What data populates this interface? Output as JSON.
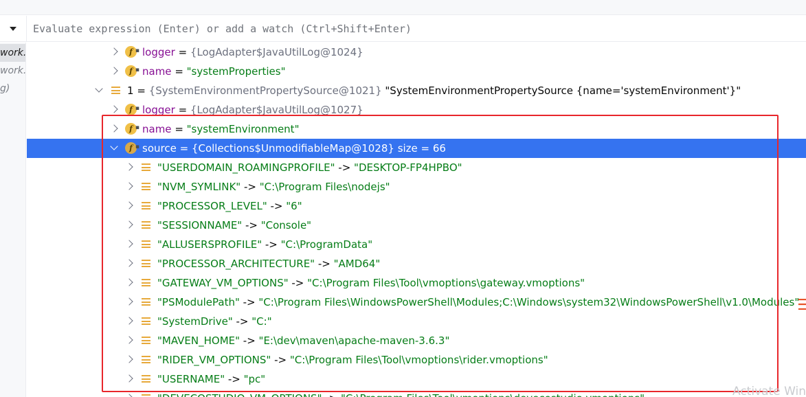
{
  "toolbar": {
    "eval_placeholder": "Evaluate expression (Enter) or add a watch (Ctrl+Shift+Enter)"
  },
  "frames": [
    "work.",
    "work.c",
    "g)"
  ],
  "rows": [
    {
      "indent": 1,
      "expand": "right",
      "icon": "field",
      "name": "logger",
      "op": " = ",
      "ref": "{LogAdapter$JavaUtilLog@1024}"
    },
    {
      "indent": 1,
      "expand": "right",
      "icon": "field",
      "name": "name",
      "op": " = ",
      "str": "\"systemProperties\""
    },
    {
      "indent": 0,
      "expand": "down",
      "icon": "list",
      "name": "1",
      "op": " = ",
      "ref": "{SystemEnvironmentPropertySource@1021}",
      "tail": " \"SystemEnvironmentPropertySource {name='systemEnvironment'}\""
    },
    {
      "indent": 1,
      "expand": "right",
      "icon": "field",
      "name": "logger",
      "op": " = ",
      "ref": "{LogAdapter$JavaUtilLog@1027}"
    },
    {
      "indent": 1,
      "expand": "right",
      "icon": "field",
      "name": "name",
      "op": " = ",
      "str": "\"systemEnvironment\""
    },
    {
      "indent": 1,
      "expand": "down",
      "icon": "field",
      "selected": true,
      "name": "source",
      "op": " = ",
      "ref": "{Collections$UnmodifiableMap@1028}",
      "tail": "  size = 66"
    },
    {
      "indent": 2,
      "expand": "right",
      "icon": "list",
      "key": "\"USERDOMAIN_ROAMINGPROFILE\"",
      "op": " -> ",
      "str": "\"DESKTOP-FP4HPBO\""
    },
    {
      "indent": 2,
      "expand": "right",
      "icon": "list",
      "key": "\"NVM_SYMLINK\"",
      "op": " -> ",
      "str": "\"C:\\Program Files\\nodejs\""
    },
    {
      "indent": 2,
      "expand": "right",
      "icon": "list",
      "key": "\"PROCESSOR_LEVEL\"",
      "op": " -> ",
      "str": "\"6\""
    },
    {
      "indent": 2,
      "expand": "right",
      "icon": "list",
      "key": "\"SESSIONNAME\"",
      "op": " -> ",
      "str": "\"Console\""
    },
    {
      "indent": 2,
      "expand": "right",
      "icon": "list",
      "key": "\"ALLUSERSPROFILE\"",
      "op": " -> ",
      "str": "\"C:\\ProgramData\""
    },
    {
      "indent": 2,
      "expand": "right",
      "icon": "list",
      "key": "\"PROCESSOR_ARCHITECTURE\"",
      "op": " -> ",
      "str": "\"AMD64\""
    },
    {
      "indent": 2,
      "expand": "right",
      "icon": "list",
      "key": "\"GATEWAY_VM_OPTIONS\"",
      "op": " -> ",
      "str": "\"C:\\Program Files\\Tool\\vmoptions\\gateway.vmoptions\""
    },
    {
      "indent": 2,
      "expand": "right",
      "icon": "list",
      "key": "\"PSModulePath\"",
      "op": " -> ",
      "str": "\"C:\\Program Files\\WindowsPowerShell\\Modules;C:\\Windows\\system32\\WindowsPowerShell\\v1.0\\Modules\""
    },
    {
      "indent": 2,
      "expand": "right",
      "icon": "list",
      "key": "\"SystemDrive\"",
      "op": " -> ",
      "str": "\"C:\""
    },
    {
      "indent": 2,
      "expand": "right",
      "icon": "list",
      "key": "\"MAVEN_HOME\"",
      "op": " -> ",
      "str": "\"E:\\dev\\maven\\apache-maven-3.6.3\""
    },
    {
      "indent": 2,
      "expand": "right",
      "icon": "list",
      "key": "\"RIDER_VM_OPTIONS\"",
      "op": " -> ",
      "str": "\"C:\\Program Files\\Tool\\vmoptions\\rider.vmoptions\""
    },
    {
      "indent": 2,
      "expand": "right",
      "icon": "list",
      "key": "\"USERNAME\"",
      "op": " -> ",
      "str": "\"pc\""
    },
    {
      "indent": 2,
      "expand": "right",
      "icon": "list",
      "key": "\"DEVECOSTUDIO_VM_OPTIONS\"",
      "op": " -> ",
      "str": "\"C:\\Program Files\\Tool\\vmoptions\\devecostudio.vmoptions\""
    }
  ],
  "watermark": "Activate Win",
  "colors": {
    "selection": "#3573f0",
    "annotation_box": "#e8262b",
    "string_value": "#067d17",
    "field_name": "#871094"
  }
}
